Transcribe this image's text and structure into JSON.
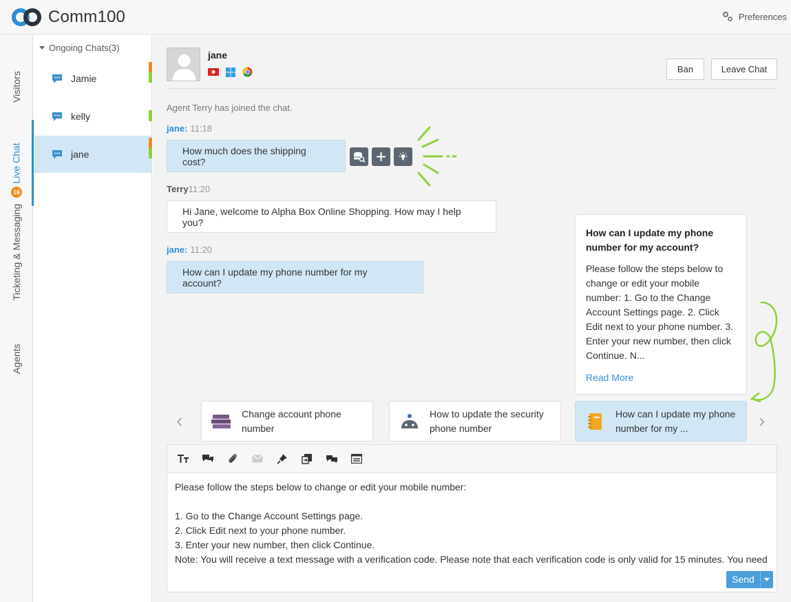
{
  "app": {
    "brand": "Comm100",
    "preferences_label": "Preferences"
  },
  "nav": {
    "tabs": [
      {
        "label": "Visitors"
      },
      {
        "label": "Live Chat"
      },
      {
        "label": "Ticketing & Messaging",
        "badge": "16"
      },
      {
        "label": "Agents"
      }
    ]
  },
  "chatlist": {
    "group_label": "Ongoing Chats(3)",
    "items": [
      {
        "name": "Jamie"
      },
      {
        "name": "kelly"
      },
      {
        "name": "jane"
      }
    ]
  },
  "visitor": {
    "name": "jane"
  },
  "actions": {
    "ban": "Ban",
    "leave": "Leave Chat"
  },
  "messages": {
    "system": "Agent Terry has joined the chat.",
    "m1": {
      "who": "jane:",
      "time": "11:18",
      "text": "How much does the shipping cost?"
    },
    "m2": {
      "who": "Terry",
      "time": "11:20",
      "text": "Hi Jane, welcome to Alpha Box Online Shopping. How may I help you?"
    },
    "m3": {
      "who": "jane:",
      "time": "11:20",
      "text": "How can I update my phone number for my account?"
    }
  },
  "kb": {
    "question": "How can I update my phone number for my account?",
    "answer": "Please follow the steps below to change or edit your mobile number: 1. Go to the Change Account Settings page. 2. Click Edit next to your phone number. 3. Enter your new number, then click Continue. N...",
    "read_more": "Read More"
  },
  "suggestions": [
    {
      "text": "Change account phone number"
    },
    {
      "text": "How to update the security phone number"
    },
    {
      "text": "How can I update my phone number for my ..."
    }
  ],
  "composer": {
    "lines": [
      "Please follow the steps below to change or edit your mobile number:",
      "",
      "1. Go to the Change Account Settings page.",
      "2. Click Edit next to your phone number.",
      "3. Enter your new number, then click Continue.",
      "Note: You will receive a text message with a verification code. Please note that each verification code is only valid for 15 minutes. You need"
    ],
    "send_label": "Send"
  },
  "colors": {
    "accent": "#2e8ed3",
    "visitor_bubble": "#d1e7f5",
    "badge": "#f08a24",
    "annotation": "#8fd13c"
  }
}
